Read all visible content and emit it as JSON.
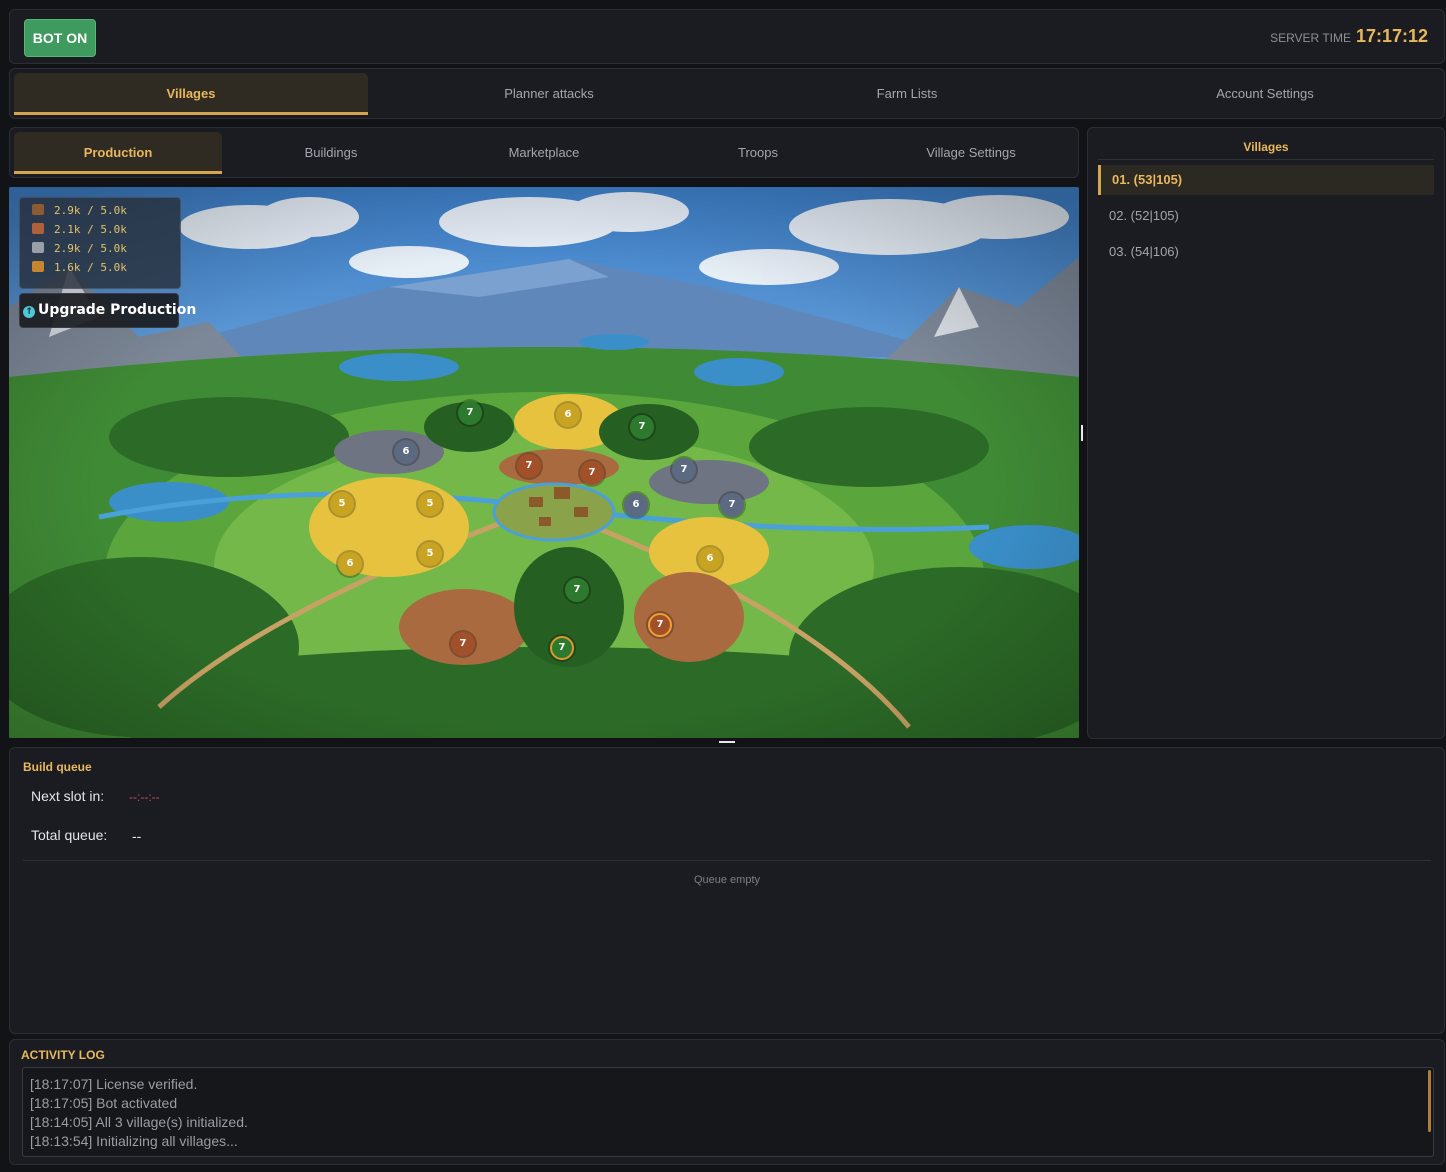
{
  "topbar": {
    "bot_button": "BOT ON",
    "server_time_label": "SERVER TIME",
    "server_time": "17:17:12"
  },
  "main_tabs": [
    {
      "label": "Villages",
      "active": true
    },
    {
      "label": "Planner attacks",
      "active": false
    },
    {
      "label": "Farm Lists",
      "active": false
    },
    {
      "label": "Account Settings",
      "active": false
    }
  ],
  "sub_tabs": [
    {
      "label": "Production",
      "active": true
    },
    {
      "label": "Buildings",
      "active": false
    },
    {
      "label": "Marketplace",
      "active": false
    },
    {
      "label": "Troops",
      "active": false
    },
    {
      "label": "Village Settings",
      "active": false
    }
  ],
  "resources": [
    {
      "name": "lumber",
      "icon": "wood-log-icon",
      "value": "2.9k / 5.0k"
    },
    {
      "name": "clay",
      "icon": "clay-brick-icon",
      "value": "2.1k / 5.0k"
    },
    {
      "name": "iron",
      "icon": "iron-ore-icon",
      "value": "2.9k / 5.0k"
    },
    {
      "name": "crop",
      "icon": "wheat-icon",
      "value": "1.6k / 5.0k"
    }
  ],
  "upgrade_button": "Upgrade Production",
  "fields": [
    {
      "type": "wood",
      "level": "7"
    },
    {
      "type": "crop",
      "level": "6"
    },
    {
      "type": "wood",
      "level": "7"
    },
    {
      "type": "iron",
      "level": "6"
    },
    {
      "type": "clay",
      "level": "7"
    },
    {
      "type": "clay",
      "level": "7"
    },
    {
      "type": "iron",
      "level": "7"
    },
    {
      "type": "iron",
      "level": "6"
    },
    {
      "type": "iron",
      "level": "7"
    },
    {
      "type": "crop",
      "level": "5"
    },
    {
      "type": "crop",
      "level": "5"
    },
    {
      "type": "crop",
      "level": "6"
    },
    {
      "type": "crop",
      "level": "5"
    },
    {
      "type": "crop",
      "level": "6"
    },
    {
      "type": "wood",
      "level": "7"
    },
    {
      "type": "clay",
      "level": "7"
    },
    {
      "type": "wood",
      "level": "7"
    },
    {
      "type": "clay",
      "level": "7"
    }
  ],
  "villages_panel": {
    "title": "Villages",
    "items": [
      {
        "label": "01.  (53|105)",
        "active": true
      },
      {
        "label": "02.  (52|105)",
        "active": false
      },
      {
        "label": "03.  (54|106)",
        "active": false
      }
    ]
  },
  "build_queue": {
    "title": "Build queue",
    "next_slot_label": "Next slot in:",
    "next_slot_value": "--:--:--",
    "total_queue_label": "Total queue:",
    "total_queue_value": "--",
    "empty_text": "Queue empty"
  },
  "activity_log": {
    "title": "ACTIVITY LOG",
    "lines": [
      "[18:17:07] License verified.",
      "[18:17:05] Bot activated",
      "[18:14:05] All 3 village(s) initialized.",
      "[18:13:54] Initializing all villages..."
    ]
  },
  "colors": {
    "accent": "#e9b85d",
    "bot_on": "#3f9a5f",
    "background": "#121317",
    "panel": "#1b1c21",
    "countdown": "#d0495a"
  }
}
